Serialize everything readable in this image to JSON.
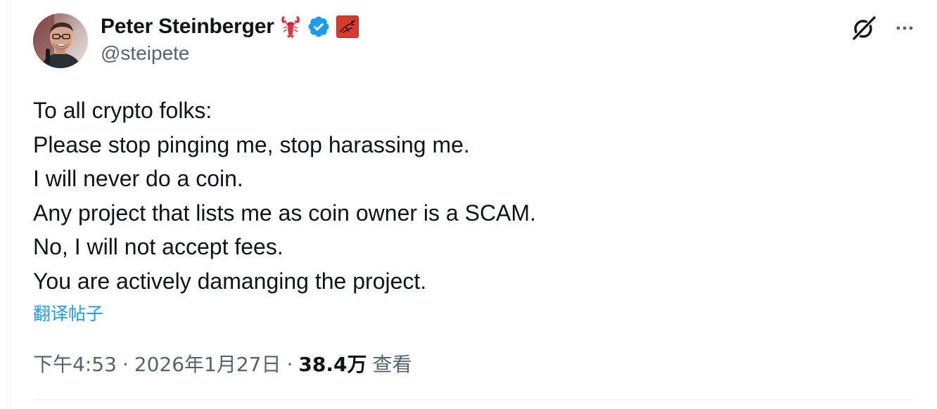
{
  "author": {
    "display_name": "Peter Steinberger",
    "handle": "@steipete"
  },
  "icons": {
    "name_emoji": "lobster-icon",
    "verified": "verified-badge-icon",
    "affiliate": "affiliate-badge-icon",
    "grok": "grok-icon",
    "more": "more-options-icon"
  },
  "colors": {
    "text": "#0f1419",
    "secondary": "#536471",
    "link": "#1d9bf0",
    "verified": "#1d9bf0",
    "lobster": "#e0323c",
    "affiliate_bg": "#d93a2b"
  },
  "tweet": {
    "lines": [
      "To all crypto folks:",
      "Please stop pinging me, stop harassing me.",
      "I will never do a coin.",
      "Any project that lists me as coin owner is a SCAM.",
      "No, I will not accept fees.",
      "You are actively damanging the project."
    ],
    "translate_label": "翻译帖子"
  },
  "meta": {
    "time": "下午4:53",
    "separator": "·",
    "date": "2026年1月27日",
    "views_count": "38.4万",
    "views_label": "查看"
  }
}
